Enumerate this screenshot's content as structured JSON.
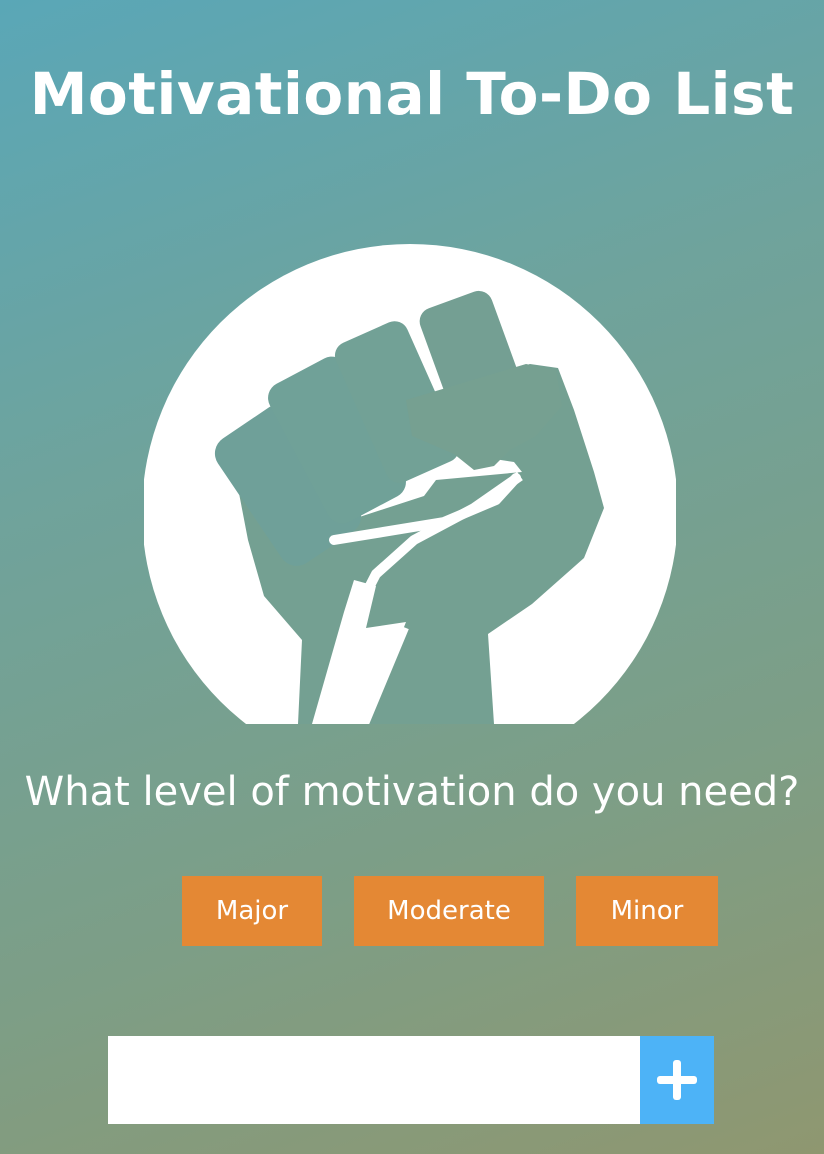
{
  "header": {
    "title": "Motivational To-Do List"
  },
  "emblem": {
    "icon": "raised-fist-icon"
  },
  "prompt": {
    "question": "What level of motivation do you need?"
  },
  "levels": {
    "major_label": "Major",
    "moderate_label": "Moderate",
    "minor_label": "Minor"
  },
  "task_entry": {
    "value": "",
    "placeholder": "",
    "add_icon": "plus-icon"
  },
  "colors": {
    "level_button": "#e48834",
    "add_button": "#4db3f7"
  }
}
